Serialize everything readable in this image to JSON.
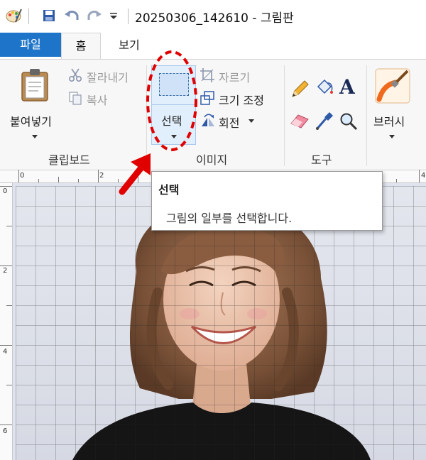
{
  "window": {
    "title": "20250306_142610 - 그림판"
  },
  "quick_access": {
    "app_icon": "paint-palette-icon",
    "save_icon": "save-icon",
    "undo_icon": "undo-icon",
    "redo_icon": "redo-icon",
    "customize_icon": "dropdown-caret-icon"
  },
  "tabs": [
    {
      "label": "파일"
    },
    {
      "label": "홈"
    },
    {
      "label": "보기"
    }
  ],
  "ribbon": {
    "clipboard": {
      "group_label": "클립보드",
      "paste": "붙여넣기",
      "cut": "잘라내기",
      "copy": "복사"
    },
    "image": {
      "group_label": "이미지",
      "select": "선택",
      "crop": "자르기",
      "resize": "크기 조정",
      "rotate": "회전"
    },
    "tools": {
      "group_label": "도구",
      "pencil_icon": "pencil-icon",
      "fill_icon": "paint-bucket-icon",
      "text_icon": "text-icon",
      "eraser_icon": "eraser-icon",
      "picker_icon": "color-picker-icon",
      "magnifier_icon": "magnifier-icon"
    },
    "brushes": {
      "label": "브러시"
    }
  },
  "rulers": {
    "top": [
      "0",
      "2",
      "4"
    ],
    "left": [
      "0",
      "2",
      "4",
      "6"
    ]
  },
  "tooltip": {
    "title": "선택",
    "description": "그림의 일부를 선택합니다."
  },
  "colors": {
    "file_tab": "#1e74c8",
    "annotation_red": "#e00000",
    "select_highlight": "#e1eefb"
  }
}
